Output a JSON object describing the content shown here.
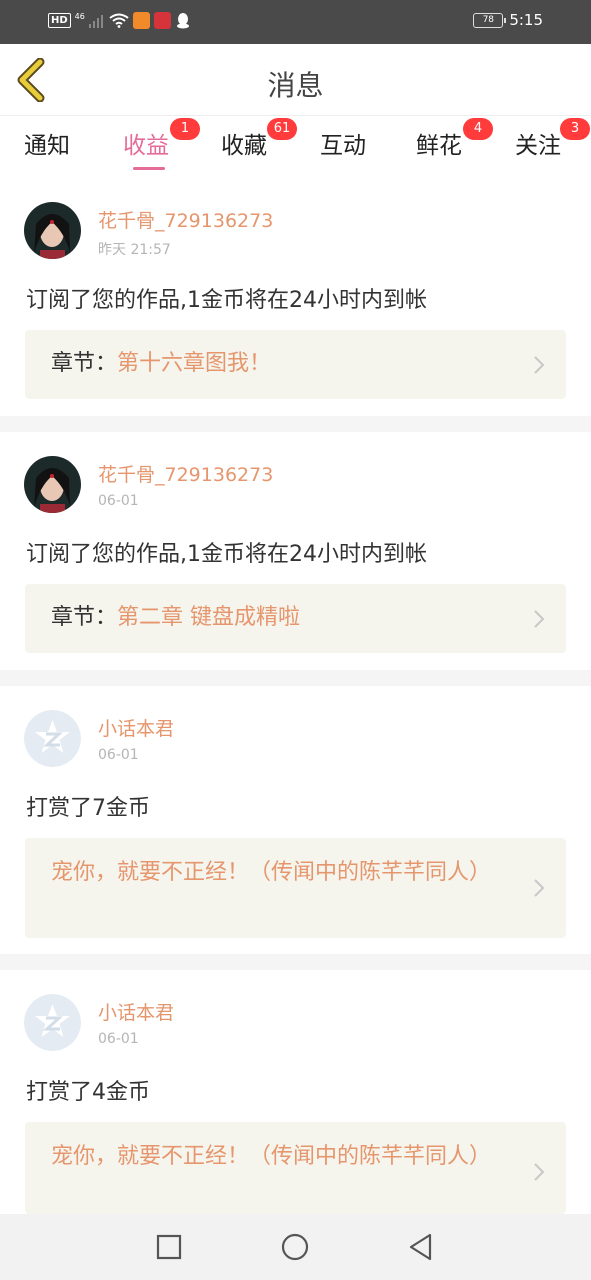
{
  "status_bar": {
    "hd_label": "HD",
    "network": "46",
    "battery": "78",
    "time": "5:15"
  },
  "header": {
    "title": "消息"
  },
  "tabs": [
    {
      "label": "通知",
      "badge": ""
    },
    {
      "label": "收益",
      "badge": "1"
    },
    {
      "label": "收藏",
      "badge": "61"
    },
    {
      "label": "互动",
      "badge": ""
    },
    {
      "label": "鲜花",
      "badge": "4"
    },
    {
      "label": "关注",
      "badge": "3"
    }
  ],
  "active_tab": "收益",
  "messages": [
    {
      "user": "花千骨_729136273",
      "time": "昨天 21:57",
      "text": "订阅了您的作品,1金币将在24小时内到帐",
      "link_label": "章节：",
      "link_value": "第十六章图我！"
    },
    {
      "user": "花千骨_729136273",
      "time": "06-01",
      "text": "订阅了您的作品,1金币将在24小时内到帐",
      "link_label": "章节：",
      "link_value": "第二章 键盘成精啦"
    },
    {
      "user": "小话本君",
      "time": "06-01",
      "text": "打赏了7金币",
      "link_label": "",
      "link_value": "宠你，就要不正经！（传闻中的陈芊芊同人）"
    },
    {
      "user": "小话本君",
      "time": "06-01",
      "text": "打赏了4金币",
      "link_label": "",
      "link_value": "宠你，就要不正经！（传闻中的陈芊芊同人）"
    }
  ],
  "colors": {
    "accent_pink": "#e56c98",
    "username_orange": "#e6966d",
    "badge_red": "#ff3b3b",
    "link_box_bg": "#f5f5ee",
    "back_arrow_yellow": "#e8cd3a"
  },
  "icons": [
    "back-arrow-icon",
    "chevron-right-icon",
    "square-nav-icon",
    "circle-nav-icon",
    "triangle-back-nav-icon"
  ]
}
